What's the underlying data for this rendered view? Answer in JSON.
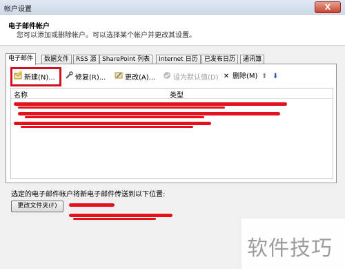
{
  "window": {
    "title": "帐户设置",
    "close_glyph": "X"
  },
  "header": {
    "title": "电子邮件帐户",
    "description": "您可以添加或删除帐户。可以选择某个帐户并更改其设置。"
  },
  "tabs": [
    {
      "label": "电子邮件",
      "active": true
    },
    {
      "label": "数据文件"
    },
    {
      "label": "RSS 源"
    },
    {
      "label": "SharePoint 列表"
    },
    {
      "label": "Internet 日历"
    },
    {
      "label": "已发布日历"
    },
    {
      "label": "通讯簿"
    }
  ],
  "toolbar": {
    "new": {
      "label": "新建(N)...",
      "icon": "new-account-icon"
    },
    "repair": {
      "label": "修复(R)...",
      "icon": "repair-icon"
    },
    "change": {
      "label": "更改(A)...",
      "icon": "change-icon"
    },
    "set_default": {
      "label": "设为默认值(D)",
      "icon": "checkmark-icon"
    },
    "delete": {
      "label": "删除(M)",
      "icon": "delete-icon",
      "glyph": "✕"
    },
    "move_up": {
      "glyph": "⬆",
      "icon": "move-up-icon"
    },
    "move_down": {
      "glyph": "⬇",
      "icon": "move-down-icon"
    }
  },
  "list": {
    "columns": [
      "名称",
      "类型"
    ],
    "rows_redacted": true
  },
  "delivery": {
    "label": "选定的电子邮件帐户将新电子邮件传送到以下位置:",
    "change_folder_button": "更改文件夹(F)"
  },
  "watermark": "软件技巧",
  "colors": {
    "highlight_box": "#d4101e",
    "redaction": "#e4101c"
  }
}
